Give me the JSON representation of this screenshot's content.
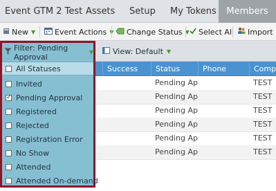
{
  "tabs": [
    {
      "label": "Event GTM 2 Test",
      "active": false
    },
    {
      "label": "Assets",
      "active": false
    },
    {
      "label": "Setup",
      "active": false
    },
    {
      "label": "My Tokens",
      "active": false
    },
    {
      "label": "Members",
      "active": true
    }
  ],
  "toolbar": {
    "new_label": "New",
    "event_actions_label": "Event Actions",
    "change_status_label": "Change Status",
    "select_all_label": "Select All",
    "import_label": "Import"
  },
  "filter": {
    "label": "Filter: Pending Approval",
    "view_label": "View: Default"
  },
  "status_options": [
    {
      "label": "All Statuses",
      "checked": false
    },
    {
      "label": "Invited",
      "checked": false
    },
    {
      "label": "Pending Approval",
      "checked": true
    },
    {
      "label": "Registered",
      "checked": false
    },
    {
      "label": "Rejected",
      "checked": false
    },
    {
      "label": "Registration Error",
      "checked": false
    },
    {
      "label": "No Show",
      "checked": false
    },
    {
      "label": "Attended",
      "checked": false
    },
    {
      "label": "Attended On-demand",
      "checked": false
    }
  ],
  "grid": {
    "columns": [
      "Success",
      "Status",
      "Phone",
      "Comp"
    ],
    "rows": [
      {
        "success": "",
        "status": "Pending Ap...",
        "phone": "",
        "company": "TEST"
      },
      {
        "success": "",
        "status": "Pending Ap...",
        "phone": "",
        "company": "TEST"
      },
      {
        "success": "",
        "status": "Pending Ap...",
        "phone": "",
        "company": "TEST"
      },
      {
        "success": "",
        "status": "Pending Ap...",
        "phone": "",
        "company": "TEST"
      },
      {
        "success": "",
        "status": "Pending Ap...",
        "phone": "",
        "company": "TEST"
      },
      {
        "success": "",
        "status": "Pending Ap...",
        "phone": "",
        "company": "TEST"
      }
    ]
  },
  "colors": {
    "active_tab": "#9ea3a8",
    "grid_header": "#4a93d1",
    "dropdown_bg": "#87bfd2",
    "dropdown_border": "#8a1628",
    "caret": "#4a9a2e"
  }
}
